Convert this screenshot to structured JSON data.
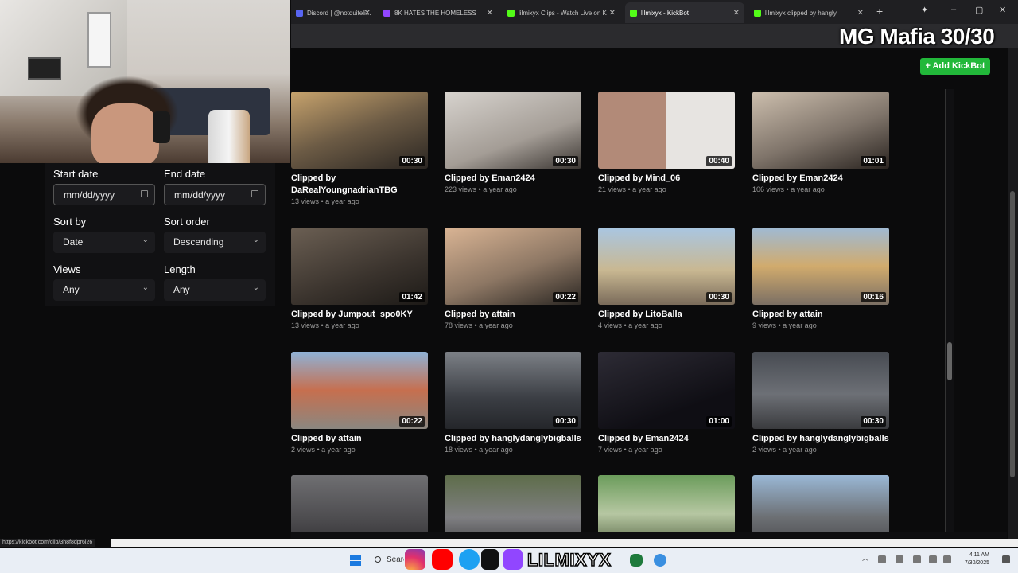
{
  "browser": {
    "tabs": [
      {
        "label": "Discord | @notquiteli...",
        "icon_color": "#5865f2"
      },
      {
        "label": "8K HATES THE HOMELESS",
        "icon_color": "#9146ff"
      },
      {
        "label": "lilmixyx Clips - Watch Live on K",
        "icon_color": "#53fc18"
      },
      {
        "label": "lilmixyx - KickBot",
        "icon_color": "#53fc18"
      },
      {
        "label": "lilmixyx clipped by hangly",
        "icon_color": "#53fc18"
      }
    ],
    "new_tab_label": "+"
  },
  "stream_overlay": {
    "title": "MG Mafia 30/30",
    "handle": "LILMIXYX"
  },
  "filters": {
    "start_date_label": "Start date",
    "start_date_placeholder": "mm/dd/yyyy",
    "end_date_label": "End date",
    "end_date_placeholder": "mm/dd/yyyy",
    "sort_by_label": "Sort by",
    "sort_by_value": "Date",
    "sort_order_label": "Sort order",
    "sort_order_value": "Descending",
    "views_label": "Views",
    "views_value": "Any",
    "length_label": "Length",
    "length_value": "Any"
  },
  "add_kickbot_label": "+ Add KickBot",
  "clips": [
    {
      "title": "Clipped by DaRealYoungnadrianTBG",
      "views": "13 views",
      "age": "a year ago",
      "duration": "00:30"
    },
    {
      "title": "Clipped by Eman2424",
      "views": "223 views",
      "age": "a year ago",
      "duration": "00:30"
    },
    {
      "title": "Clipped by Mind_06",
      "views": "21 views",
      "age": "a year ago",
      "duration": "00:40"
    },
    {
      "title": "Clipped by Eman2424",
      "views": "106 views",
      "age": "a year ago",
      "duration": "01:01"
    },
    {
      "title": "Clipped by Jumpout_spo0KY",
      "views": "13 views",
      "age": "a year ago",
      "duration": "01:42"
    },
    {
      "title": "Clipped by attain",
      "views": "78 views",
      "age": "a year ago",
      "duration": "00:22"
    },
    {
      "title": "Clipped by LitoBalla",
      "views": "4 views",
      "age": "a year ago",
      "duration": "00:30"
    },
    {
      "title": "Clipped by attain",
      "views": "9 views",
      "age": "a year ago",
      "duration": "00:16"
    },
    {
      "title": "Clipped by attain",
      "views": "2 views",
      "age": "a year ago",
      "duration": "00:22"
    },
    {
      "title": "Clipped by hanglydanglybigballs",
      "views": "18 views",
      "age": "a year ago",
      "duration": "00:30"
    },
    {
      "title": "Clipped by Eman2424",
      "views": "7 views",
      "age": "a year ago",
      "duration": "01:00"
    },
    {
      "title": "Clipped by hanglydanglybigballs",
      "views": "2 views",
      "age": "a year ago",
      "duration": "00:30"
    },
    {
      "title": "",
      "views": "",
      "age": "",
      "duration": ""
    },
    {
      "title": "",
      "views": "",
      "age": "",
      "duration": ""
    },
    {
      "title": "",
      "views": "",
      "age": "",
      "duration": ""
    },
    {
      "title": "",
      "views": "",
      "age": "",
      "duration": ""
    }
  ],
  "status_url": "https://kickbot.com/clip/3h8f8dpr6l26",
  "taskbar": {
    "search_label": "Search",
    "time": "4:11 AM",
    "date": "7/30/2025"
  },
  "colors": {
    "accent_green": "#22b83a",
    "background": "#0b0b0c"
  }
}
